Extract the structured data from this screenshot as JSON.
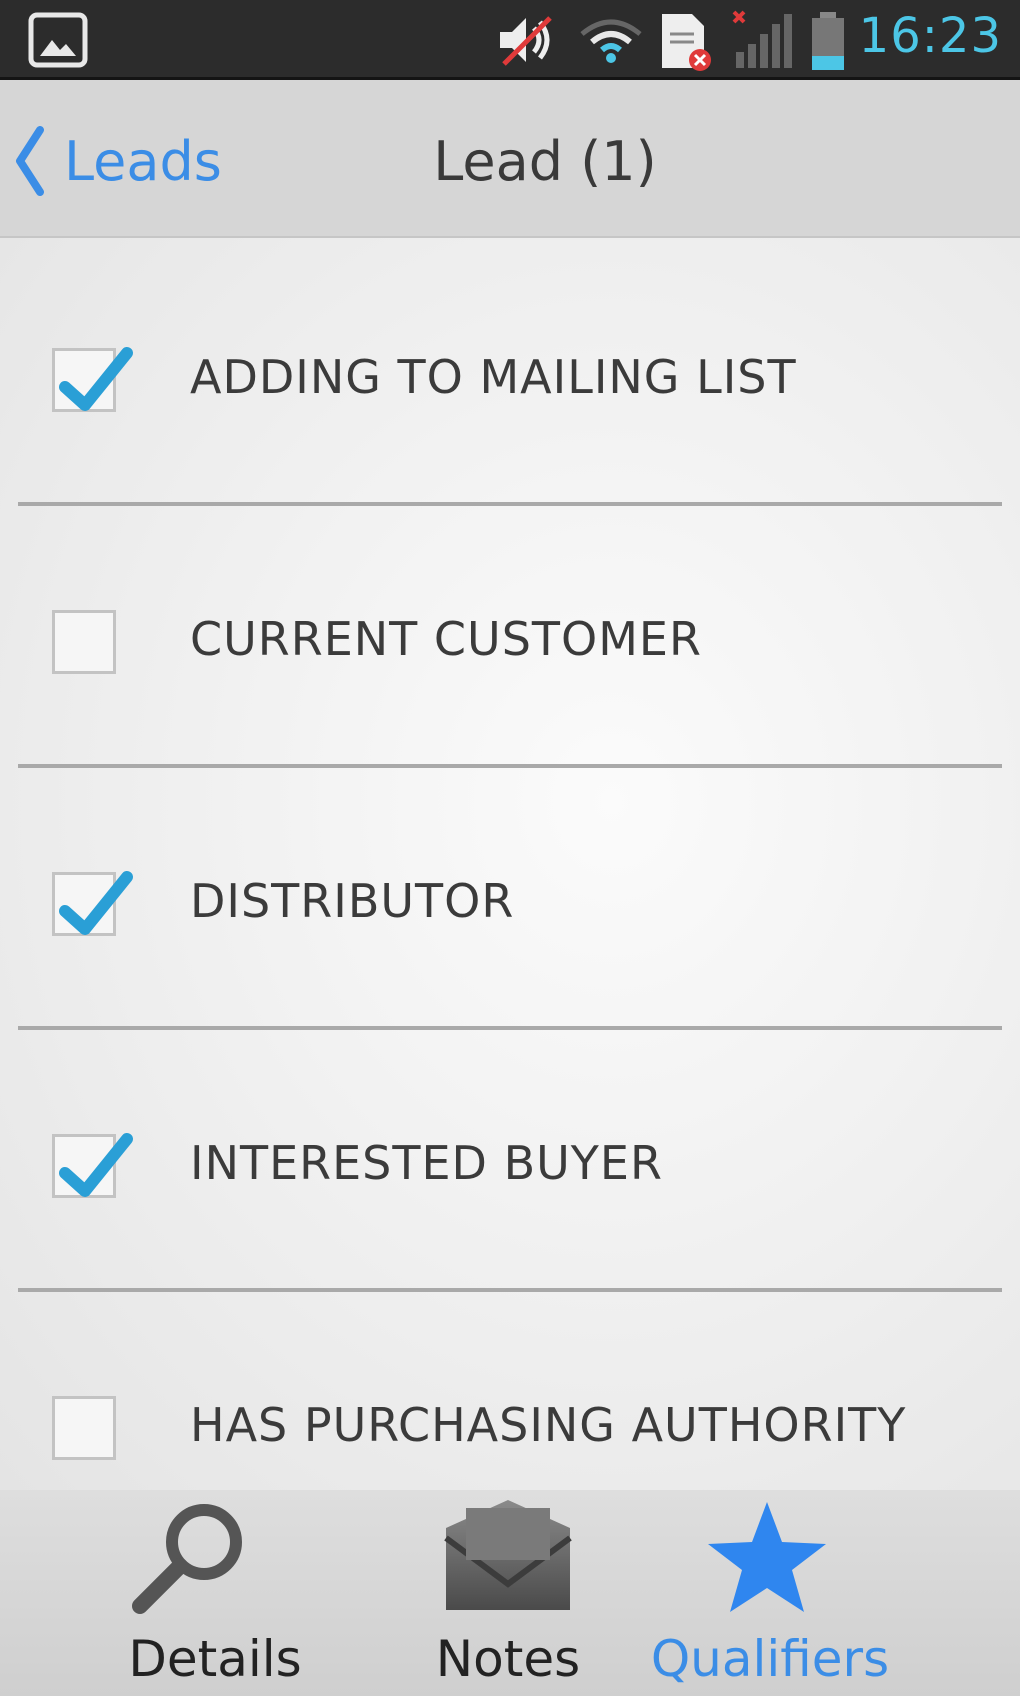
{
  "status_bar": {
    "time": "16:23",
    "icons": [
      "gallery-icon",
      "volume-muted-icon",
      "wifi-icon",
      "sd-card-error-icon",
      "signal-no-service-icon",
      "battery-icon"
    ],
    "clock_color": "#4cc6e6"
  },
  "action_bar": {
    "back_label": "Leads",
    "title": "Lead (1)",
    "accent": "#3b8de6"
  },
  "qualifiers": [
    {
      "label": "ADDING TO MAILING LIST",
      "checked": true
    },
    {
      "label": "CURRENT CUSTOMER",
      "checked": false
    },
    {
      "label": "DISTRIBUTOR",
      "checked": true
    },
    {
      "label": "INTERESTED BUYER",
      "checked": true
    },
    {
      "label": "HAS PURCHASING AUTHORITY",
      "checked": false
    }
  ],
  "tabs": [
    {
      "label": "Details",
      "icon": "magnifier-icon",
      "active": false
    },
    {
      "label": "Notes",
      "icon": "envelope-icon",
      "active": false
    },
    {
      "label": "Qualifiers",
      "icon": "star-icon",
      "active": true
    }
  ],
  "colors": {
    "check_mark": "#2a9fd6",
    "active_tab": "#3b8de6"
  }
}
